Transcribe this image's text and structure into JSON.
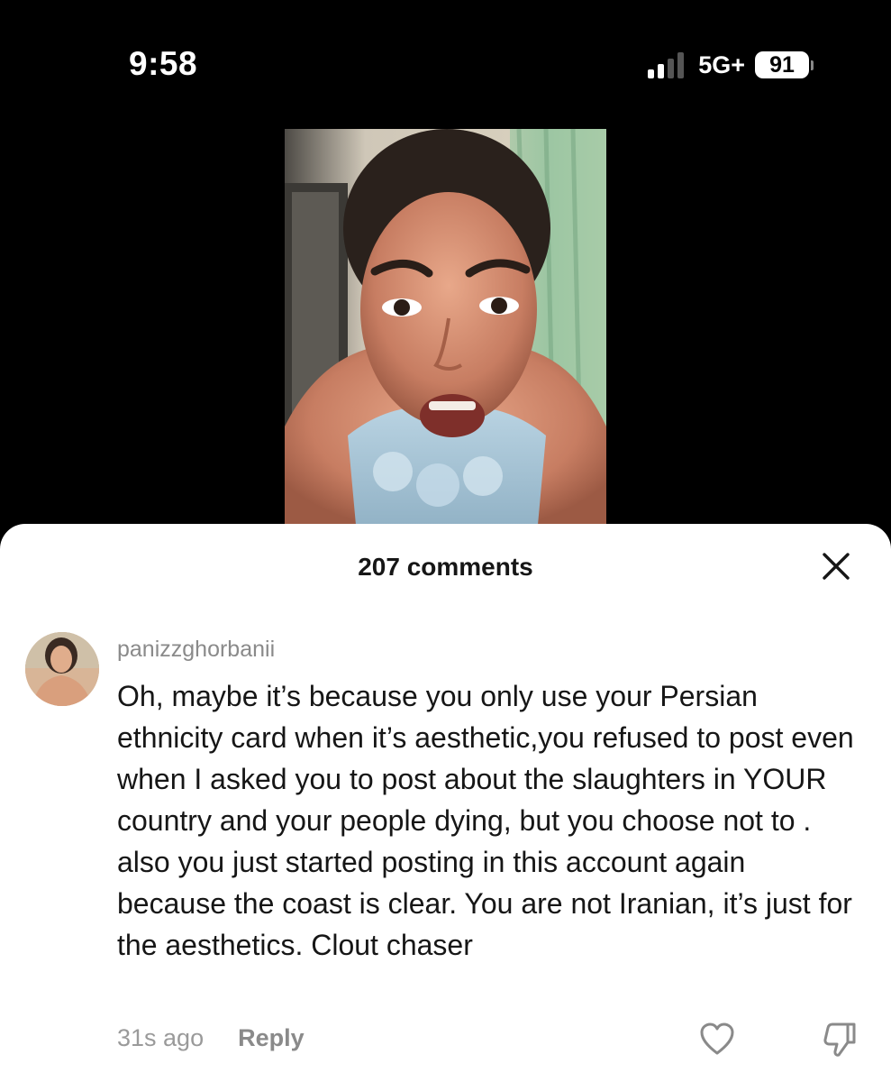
{
  "status_bar": {
    "time": "9:58",
    "network": "5G+",
    "battery": "91",
    "signal_bars_active": 2,
    "signal_bars_total": 4
  },
  "comments_sheet": {
    "title": "207 comments",
    "close_icon": "close-icon"
  },
  "comment": {
    "username": "panizzghorbanii",
    "text": "Oh, maybe it’s because you only use your Persian ethnicity card when it’s aesthetic,you refused to post even when I asked you to post about the slaughters in YOUR country and your people dying, but you choose not to . also you just started posting in this account again because the coast is clear. You are not Iranian, it’s just for the aesthetics. Clout chaser",
    "time_ago": "31s ago",
    "reply_label": "Reply",
    "like_icon": "heart-outline-icon",
    "dislike_icon": "thumbs-down-icon"
  },
  "colors": {
    "background": "#000000",
    "sheet": "#ffffff",
    "text_primary": "#161616",
    "text_secondary": "#8a8a8a"
  }
}
